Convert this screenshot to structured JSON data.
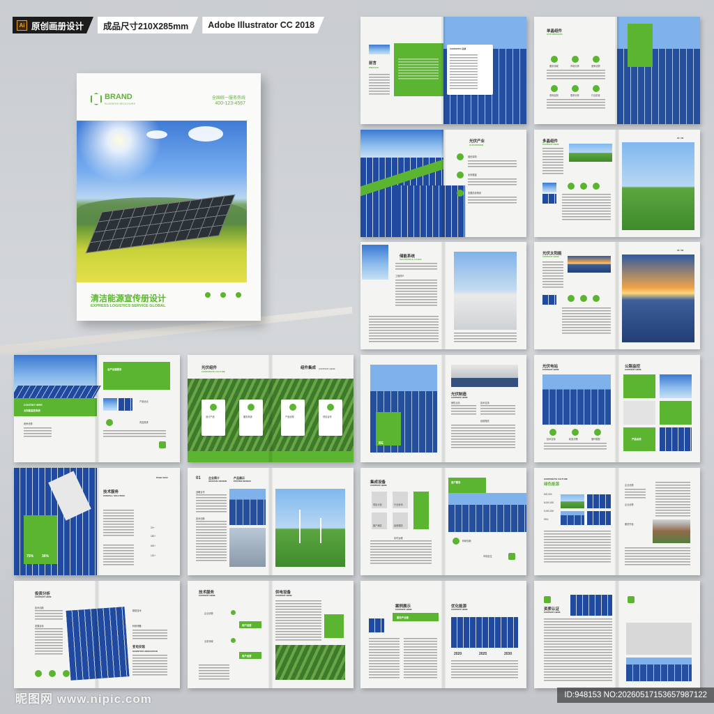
{
  "header": {
    "ai_badge": "Ai",
    "tag1": "原创画册设计",
    "tag2": "成品尺寸210X285mm",
    "tag3": "Adobe Illustrator CC 2018"
  },
  "cover": {
    "brand": "BRAND",
    "brand_sub": "BUSINESS BROCHURE",
    "hotline": "全国统一服务热线",
    "phone": "400-123-4567",
    "title": "清洁能源宣传册设计",
    "subtitle": "EXPRESS LOGISTICS SERVICE GLOBAL"
  },
  "spreads": {
    "s1": {
      "title": "前言",
      "sub": "PREFACE",
      "contents": "CONTENTS 目录"
    },
    "s2": {
      "title": "单晶组件",
      "sub": "OUR SERVICES",
      "i1": "服务领域",
      "i2": "市场分析",
      "i3": "竞争优势",
      "i4": "咨询定制",
      "i5": "需求分析",
      "i6": "行业前景"
    },
    "s3": {
      "title": "光伏产业",
      "sub": "OUR MISSION",
      "i1": "组织架构",
      "i2": "未来展望",
      "i3": "发展前景规划"
    },
    "s4": {
      "title": "多晶组件",
      "sub": "CONTENT HERE",
      "page": "01 / 02"
    },
    "s5": {
      "title": "储能系统",
      "sub": "SUCCESSFUL CASES",
      "i1": "工程简介"
    },
    "s6": {
      "title": "光伏太阳能",
      "sub": "CONTENT HERE",
      "page": "01 / 02"
    },
    "s7": {
      "title": "全产业链服务",
      "sub": "CONTENT HERE",
      "caption": "太阳能监控系统",
      "i1": "竞争优势",
      "i2": "产品优点",
      "i3": "内容需求"
    },
    "s8": {
      "title": "光伏组件",
      "sub": "CORPORATE CULTURE",
      "title2": "组件集成",
      "sub2": "CONTENT HERE",
      "c1": "设计产品",
      "c2": "服务系统",
      "c3": "产品优秀",
      "c4": "项目合作"
    },
    "s9": {
      "title": "光伏制造",
      "sub": "CONTENT HERE",
      "i1": "销售业绩",
      "i2": "技术支持",
      "i3": "经营理念",
      "badge": "BE"
    },
    "s10": {
      "title": "光伏电站",
      "sub": "CONTENT HERE",
      "title2": "公路监控",
      "sub2": "CONTENT HERE",
      "i1": "技术支持",
      "i2": "精准决策",
      "i3": "循环模型",
      "i4": "产品总成"
    },
    "s11": {
      "title": "技术服务",
      "sub": "OVERALL SOLUTION",
      "page": "PAGE 01/02",
      "p1": "75%",
      "p2": "36%",
      "v1": "20+",
      "v2": "180+",
      "v3": "600+",
      "v4": "120+"
    },
    "s12": {
      "num": "01",
      "title": "企业简介",
      "sub": "GRAPHIC DESIGN",
      "title2": "产品展示",
      "sub2": "POSTER DESIGN",
      "i1": "战略合作",
      "i2": "技术创新"
    },
    "s13": {
      "title": "集成设备",
      "sub": "CONTENT HERE",
      "banner": "客户服务",
      "i1": "项目计划",
      "i2": "行业资讯",
      "i3": "产品服务",
      "i4": "客户满意",
      "i5": "经营理念",
      "i6": "实时运维",
      "i7": "科研创新",
      "i8": "市场定位"
    },
    "s14": {
      "title": "绿色能源",
      "sub": "CORPORATE CULTURE",
      "i1": "企业优势",
      "i2": "企业优势",
      "i3": "服务宗旨",
      "n1": "600,000",
      "n2": "8,000,000",
      "n3": "5,000,000",
      "n4": "95%"
    },
    "s15": {
      "title": "投资分析",
      "sub": "CONTENT HERE",
      "i1": "技术创新",
      "i2": "发展目标",
      "i3": "模型技术",
      "i4": "科研储备",
      "i5": "变电安装",
      "i6": "SCIENTIFIC INNOVATION"
    },
    "s16": {
      "title": "技术服务",
      "sub": "CONTENT HERE",
      "title2": "供电设备",
      "sub2": "CONTENT HERE",
      "i1": "企业优势",
      "i2": "用户运营",
      "i3": "业务领域",
      "i4": "用户运营"
    },
    "s17": {
      "title": "案例展示",
      "sub": "CONTENT HERE",
      "title2": "优化能源",
      "sub2": "CONTENT HERE",
      "banner": "服务产业链",
      "y1": "2020",
      "y2": "2025",
      "y3": "2030"
    },
    "s18": {
      "title": "资质认证",
      "sub": "CONTENT HERE"
    }
  },
  "footer": {
    "watermark": "昵图网 www.nipic.com",
    "id_text": "ID:948153 NO:20260517153657987122"
  },
  "colors": {
    "accent": "#5cb531",
    "panel": "#1f4aa0"
  }
}
